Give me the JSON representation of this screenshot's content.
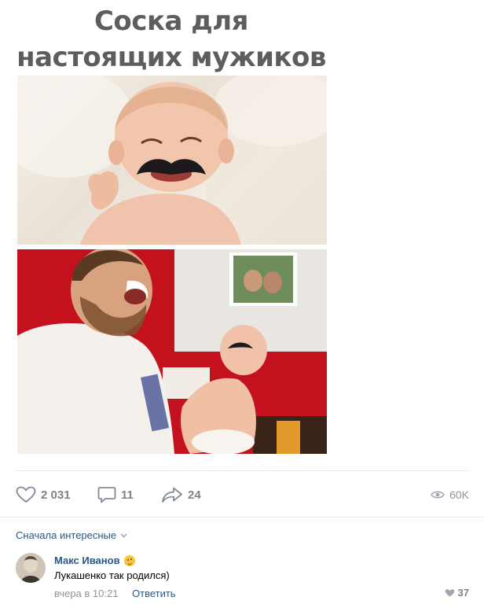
{
  "post": {
    "title_line1": "Соска для",
    "title_line2": "настоящих мужиков"
  },
  "actions": {
    "likes": "2 031",
    "comments": "11",
    "shares": "24",
    "views": "60K"
  },
  "comments_section": {
    "sort_label": "Сначала интересные",
    "items": [
      {
        "author": "Макс Иванов",
        "text": "Лукашенко так родился)",
        "time": "вчера в 10:21",
        "reply_label": "Ответить",
        "likes": "37"
      }
    ]
  },
  "icons": {
    "like": "heart-icon",
    "comment": "comment-icon",
    "share": "share-arrow-icon",
    "views": "eye-icon",
    "sort": "chevron-down-icon",
    "author_badge": "smile-emoji-icon"
  },
  "colors": {
    "link": "#2a5885",
    "muted": "#828282",
    "title": "#5d5d5d"
  }
}
